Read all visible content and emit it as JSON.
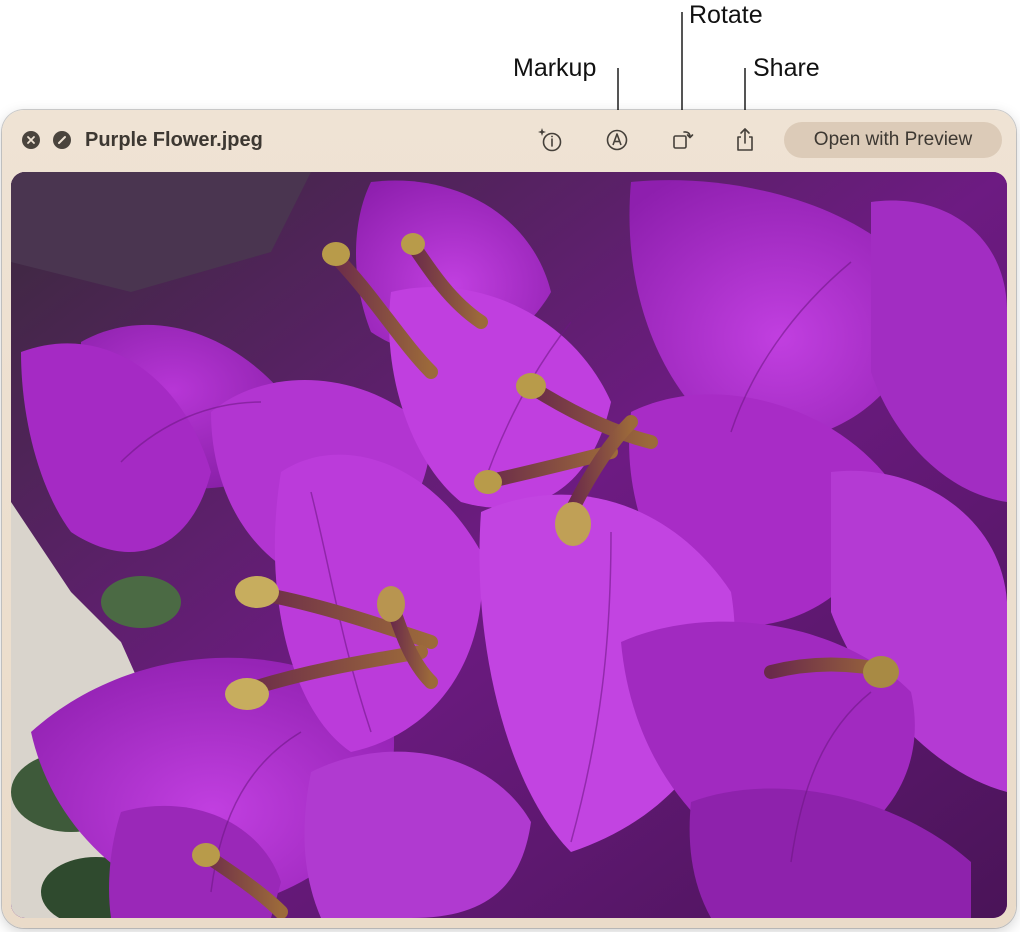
{
  "callouts": {
    "markup": "Markup",
    "rotate": "Rotate",
    "share": "Share"
  },
  "window": {
    "title": "Purple Flower.jpeg",
    "open_button_label": "Open with Preview",
    "titlebar_buttons": [
      "close-icon",
      "fullscreen-icon"
    ],
    "toolbar_icons": [
      "visual-lookup-icon",
      "markup-icon",
      "rotate-icon",
      "share-icon"
    ],
    "colors": {
      "window_bg": "#efe3d4",
      "button_bg": "#dccbb8",
      "petal": "#b42ed4",
      "petal_dark": "#7a1a8e"
    }
  }
}
